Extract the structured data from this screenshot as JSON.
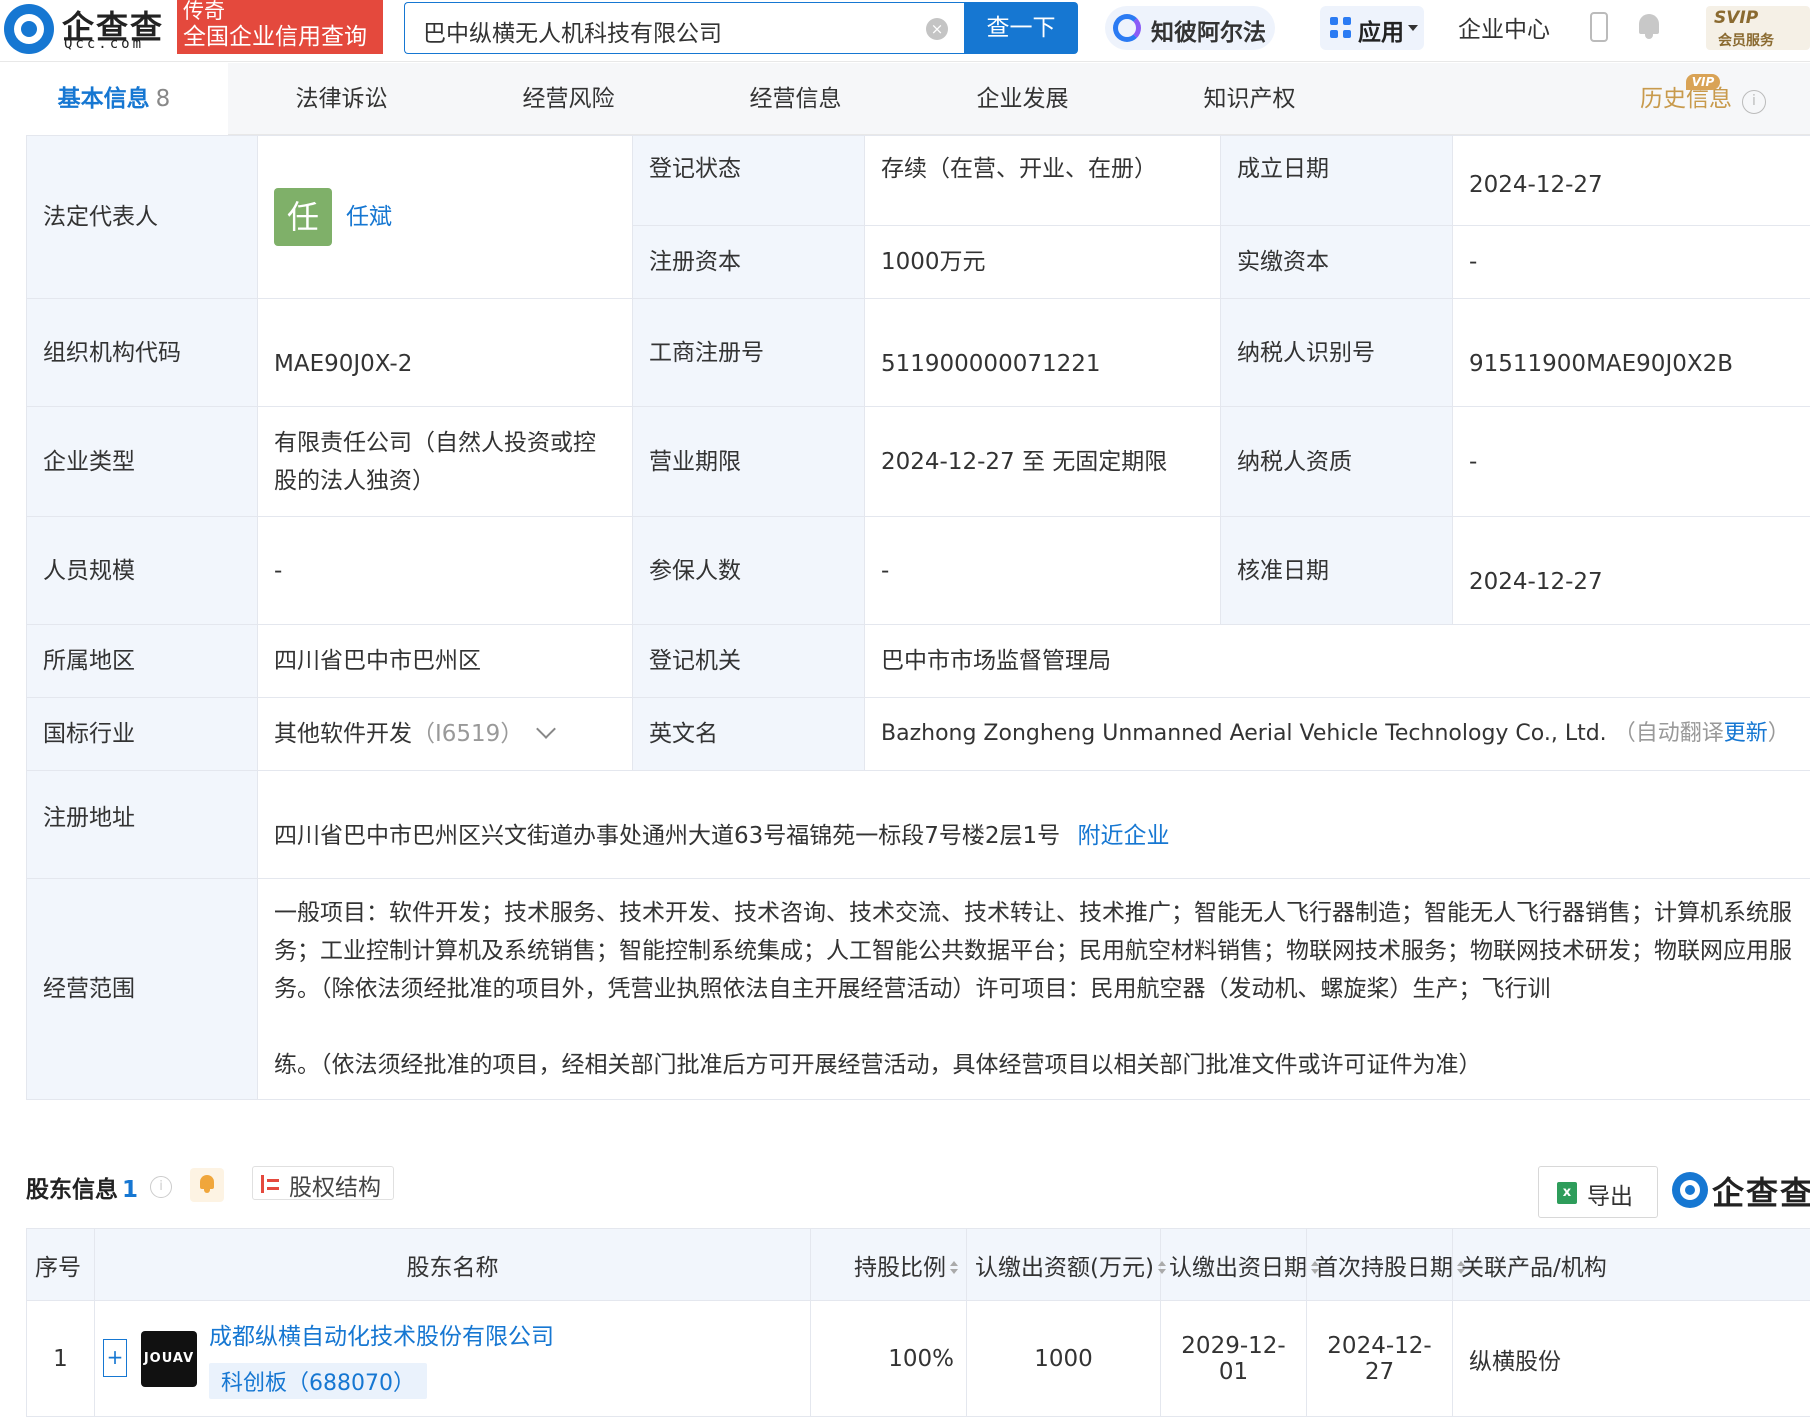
{
  "header": {
    "logo_cn": "企查查",
    "logo_en": "Qcc.com",
    "slogan_line1": "传奇",
    "slogan_line2": "全国企业信用查询",
    "search_value": "巴中纵横无人机科技有限公司",
    "search_button": "查一下",
    "ai_label": "知彼阿尔法",
    "apps_label": "应用",
    "enterprise_center": "企业中心",
    "svip_top": "SVIP",
    "svip_bottom": "会员服务"
  },
  "tabs": [
    {
      "label": "基本信息",
      "count": "8"
    },
    {
      "label": "法律诉讼"
    },
    {
      "label": "经营风险"
    },
    {
      "label": "经营信息"
    },
    {
      "label": "企业发展"
    },
    {
      "label": "知识产权"
    },
    {
      "label": "历史信息"
    }
  ],
  "vip_badge": "VIP",
  "basic": {
    "legal_rep_label": "法定代表人",
    "legal_rep_avatar": "任",
    "legal_rep_name": "任斌",
    "reg_status_label": "登记状态",
    "reg_status": "存续（在营、开业、在册）",
    "found_date_label": "成立日期",
    "found_date": "2024-12-27",
    "reg_capital_label": "注册资本",
    "reg_capital": "1000万元",
    "paid_capital_label": "实缴资本",
    "paid_capital": "-",
    "org_code_label": "组织机构代码",
    "org_code": "MAE90J0X-2",
    "biz_reg_no_label": "工商注册号",
    "biz_reg_no": "511900000071221",
    "taxpayer_id_label": "纳税人识别号",
    "taxpayer_id": "91511900MAE90J0X2B",
    "company_type_label": "企业类型",
    "company_type": "有限责任公司（自然人投资或控股的法人独资）",
    "biz_term_label": "营业期限",
    "biz_term": "2024-12-27 至 无固定期限",
    "taxpayer_qual_label": "纳税人资质",
    "taxpayer_qual": "-",
    "staff_size_label": "人员规模",
    "staff_size": "-",
    "insured_label": "参保人数",
    "insured": "-",
    "approve_date_label": "核准日期",
    "approve_date": "2024-12-27",
    "region_label": "所属地区",
    "region": "四川省巴中市巴州区",
    "authority_label": "登记机关",
    "authority": "巴中市市场监督管理局",
    "industry_label": "国标行业",
    "industry": "其他软件开发",
    "industry_code": "（I6519）",
    "english_name_label": "英文名",
    "english_name": "Bazhong Zongheng Unmanned Aerial Vehicle Technology Co., Ltd.",
    "auto_translate": "（自动翻译",
    "update_link": "更新",
    "close_paren": "）",
    "address_label": "注册地址",
    "address": "四川省巴中市巴州区兴文街道办事处通州大道63号福锦苑一标段7号楼2层1号",
    "nearby_link": "附近企业",
    "scope_label": "经营范围",
    "scope_part1": "一般项目：软件开发；技术服务、技术开发、技术咨询、技术交流、技术转让、技术推广；智能无人飞行器制造；智能无人飞行器销售；计算机系统服务；工业控制计算机及系统销售；智能控制系统集成；人工智能公共数据平台；民用航空材料销售；物联网技术服务；物联网技术研发；物联网应用服务。（除依法须经批准的项目外，凭营业执照依法自主开展经营活动）许可项目：民用航空器（发动机、螺旋桨）生产；飞行训",
    "scope_part2": "练。（依法须经批准的项目，经相关部门批准后方可开展经营活动，具体经营项目以相关部门批准文件或许可证件为准）"
  },
  "shareholders": {
    "title": "股东信息",
    "count": "1",
    "equity_button": "股权结构",
    "export_button": "导出",
    "watermark": "企查查",
    "headers": {
      "index": "序号",
      "name": "股东名称",
      "ratio": "持股比例",
      "amount": "认缴出资额(万元)",
      "date": "认缴出资日期",
      "first_date": "首次持股日期",
      "related": "关联产品/机构"
    },
    "rows": [
      {
        "index": "1",
        "logo": "JOUAV",
        "name": "成都纵横自动化技术股份有限公司",
        "tag": "科创板（688070）",
        "ratio": "100%",
        "amount": "1000",
        "date": "2029-12-01",
        "first_date": "2024-12-27",
        "related": "纵横股份"
      }
    ]
  }
}
